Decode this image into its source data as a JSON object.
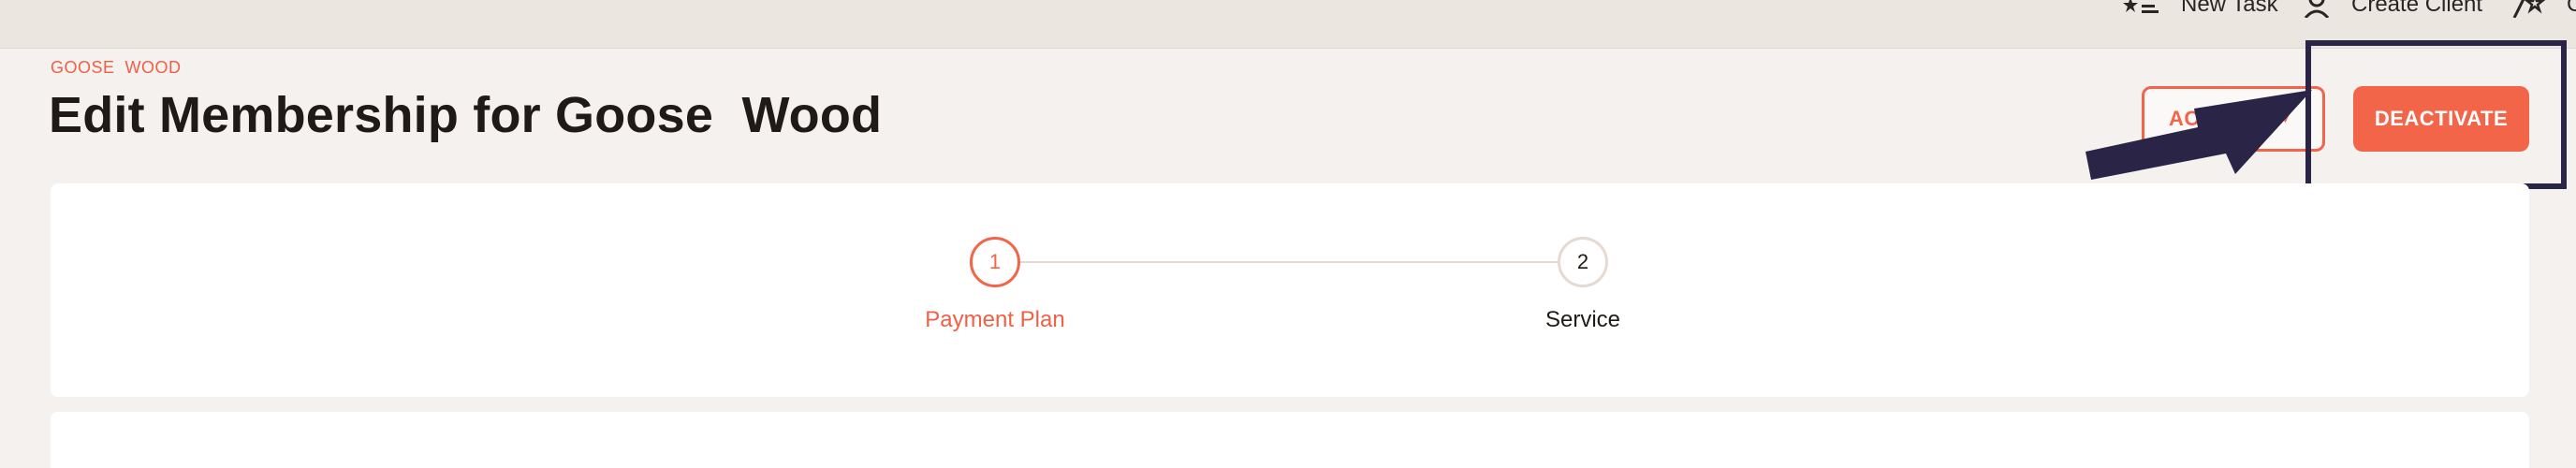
{
  "topbar": {
    "new_task_label": "New Task",
    "create_client_label": "Create Client",
    "third_label": "C"
  },
  "header": {
    "breadcrumb": "GOOSE  WOOD",
    "title": "Edit Membership for Goose  Wood",
    "actions_label": "ACTIONS",
    "deactivate_label": "DEACTIVATE"
  },
  "stepper": {
    "steps": [
      {
        "number": "1",
        "label": "Payment Plan"
      },
      {
        "number": "2",
        "label": "Service"
      }
    ]
  },
  "colors": {
    "accent": "#f26548",
    "highlight": "#2a2447",
    "background": "#f5f1ee"
  }
}
